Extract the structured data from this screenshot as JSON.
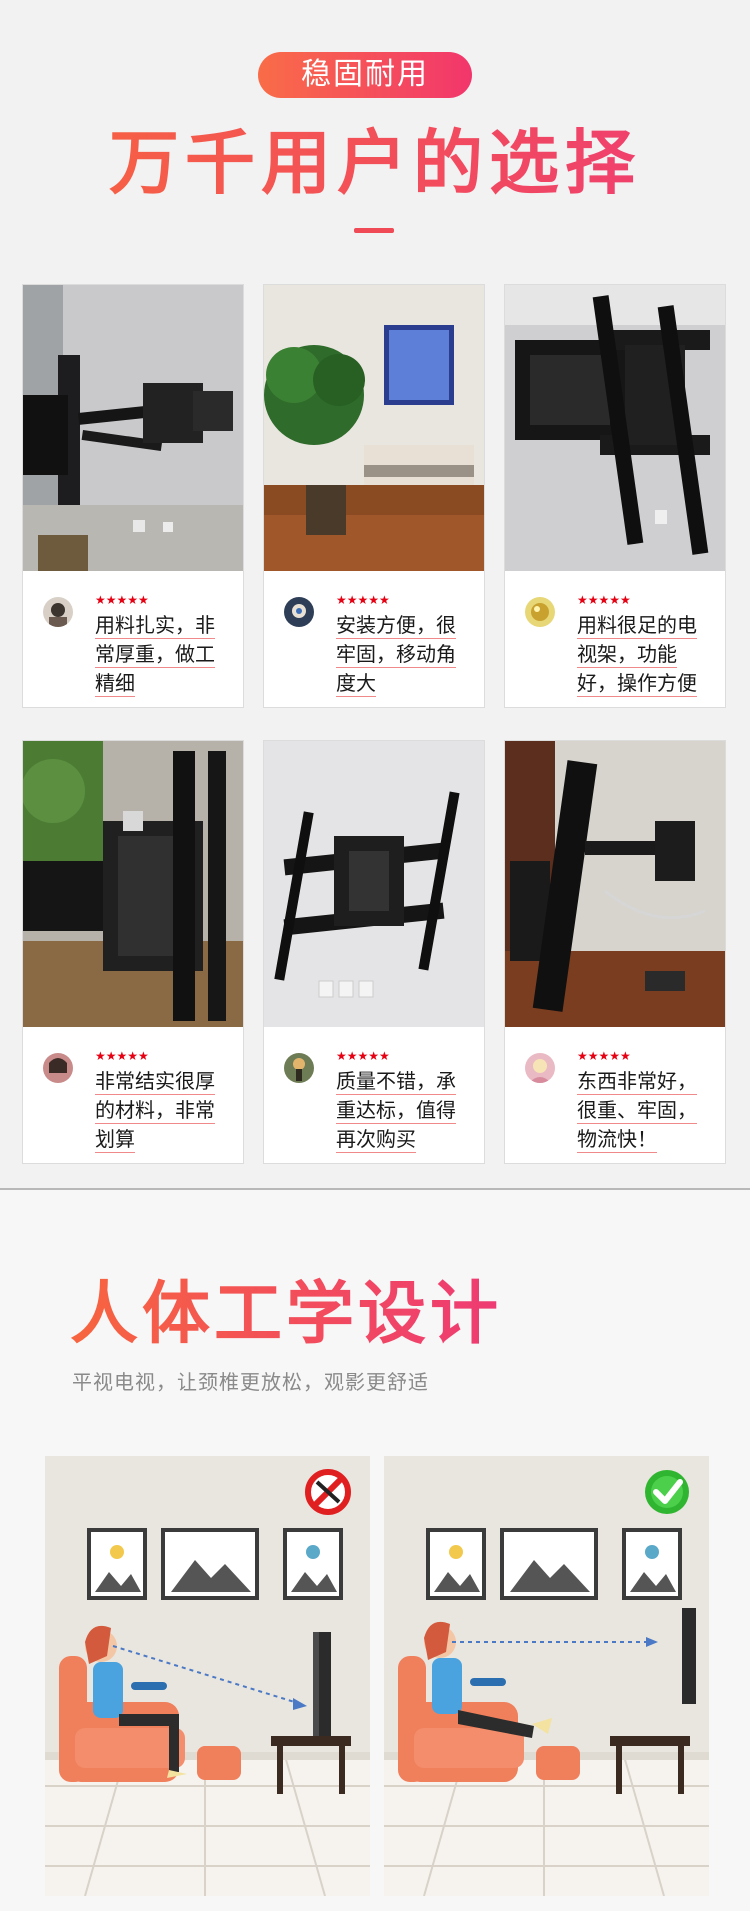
{
  "section1": {
    "badge": "稳固耐用",
    "title": "万千用户的选择"
  },
  "reviews": [
    {
      "stars": "★★★★★",
      "lines": [
        "用料扎实，非",
        "常厚重，做工",
        "精细"
      ]
    },
    {
      "stars": "★★★★★",
      "lines": [
        "安装方便，很",
        "牢固，移动角",
        "度大"
      ]
    },
    {
      "stars": "★★★★★",
      "lines": [
        "用料很足的电",
        "视架，功能",
        "好，操作方便"
      ]
    },
    {
      "stars": "★★★★★",
      "lines": [
        "非常结实很厚",
        "的材料，非常",
        "划算"
      ]
    },
    {
      "stars": "★★★★★",
      "lines": [
        "质量不错，承",
        "重达标，值得",
        "再次购买"
      ]
    },
    {
      "stars": "★★★★★",
      "lines": [
        "东西非常好，",
        "很重、牢固，",
        "物流快！"
      ]
    }
  ],
  "section2": {
    "title": "人体工学设计",
    "subtitle": "平视电视，让颈椎更放松，观影更舒适"
  },
  "colors": {
    "accent_start": "#f7653e",
    "accent_end": "#ee3a74",
    "star": "#e60012",
    "wrong": "#e02020",
    "right": "#2fb52f"
  },
  "icons": {
    "wrong": "prohibited-icon",
    "right": "checkmark-icon"
  }
}
